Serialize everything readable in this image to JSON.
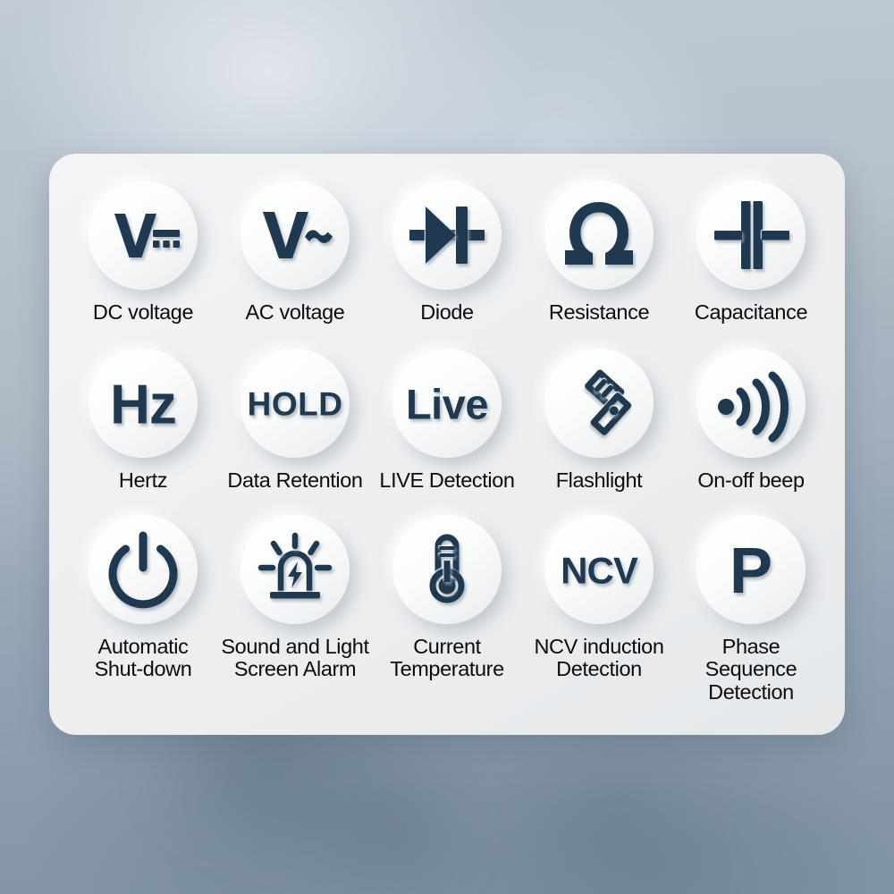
{
  "panel": {
    "accent_color": "#1e3950",
    "label_color": "#0b0c0d",
    "card_color": "#eef0f2",
    "background_color": "#9dabb9"
  },
  "rows": [
    {
      "items": [
        {
          "icon": "dc-voltage-icon",
          "symbol": "V⎓",
          "label": "DC voltage"
        },
        {
          "icon": "ac-voltage-icon",
          "symbol": "V~",
          "label": "AC voltage"
        },
        {
          "icon": "diode-icon",
          "symbol": "diode",
          "label": "Diode"
        },
        {
          "icon": "resistance-icon",
          "symbol": "Ω",
          "label": "Resistance"
        },
        {
          "icon": "capacitance-icon",
          "symbol": "capacitor",
          "label": "Capacitance"
        }
      ]
    },
    {
      "items": [
        {
          "icon": "hertz-icon",
          "symbol": "Hz",
          "label": "Hertz"
        },
        {
          "icon": "hold-icon",
          "symbol": "HOLD",
          "label": "Data Retention"
        },
        {
          "icon": "live-icon",
          "symbol": "Live",
          "label": "LIVE Detection"
        },
        {
          "icon": "flashlight-icon",
          "symbol": "flashlight",
          "label": "Flashlight"
        },
        {
          "icon": "sound-wave-icon",
          "symbol": "beep",
          "label": "On-off beep"
        }
      ]
    },
    {
      "items": [
        {
          "icon": "power-icon",
          "symbol": "power",
          "label": "Automatic\nShut-down"
        },
        {
          "icon": "alarm-siren-icon",
          "symbol": "siren",
          "label": "Sound and Light\nScreen Alarm"
        },
        {
          "icon": "thermometer-icon",
          "symbol": "thermometer",
          "label": "Current\nTemperature"
        },
        {
          "icon": "ncv-icon",
          "symbol": "NCV",
          "label": "NCV induction\nDetection"
        },
        {
          "icon": "phase-icon",
          "symbol": "P",
          "label": "Phase Sequence\nDetection"
        }
      ]
    }
  ]
}
